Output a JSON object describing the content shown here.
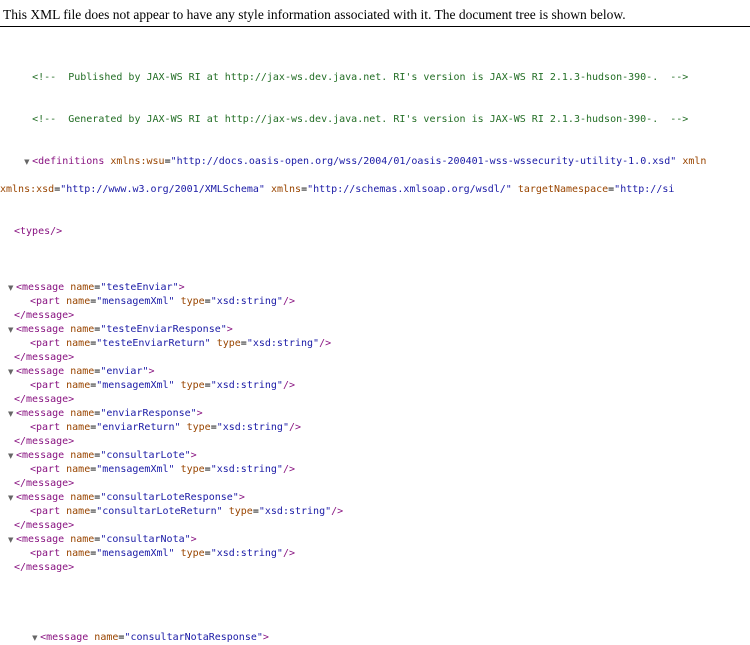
{
  "header": {
    "message": "This XML file does not appear to have any style information associated with it. The document tree is shown below."
  },
  "comments": [
    "<!--  Published by JAX-WS RI at http://jax-ws.dev.java.net. RI's version is JAX-WS RI 2.1.3-hudson-390-.  -->",
    "<!--  Generated by JAX-WS RI at http://jax-ws.dev.java.net. RI's version is JAX-WS RI 2.1.3-hudson-390-.  -->"
  ],
  "definitions": {
    "open_tag": "<definitions",
    "attr1_name": "xmlns:wsu",
    "attr1_value": "\"http://docs.oasis-open.org/wss/2004/01/oasis-200401-wss-wssecurity-utility-1.0.xsd\"",
    "attr2_name": "xmln",
    "line2_attr1_name": "xmlns:xsd",
    "line2_attr1_value": "\"http://www.w3.org/2001/XMLSchema\"",
    "line2_attr2_name": "xmlns",
    "line2_attr2_value": "\"http://schemas.xmlsoap.org/wsdl/\"",
    "line2_attr3_name": "targetNamespace",
    "line2_attr3_value": "\"http://si"
  },
  "types_tag": "<types/>",
  "messages": [
    {
      "name": "testeEnviar",
      "part": "mensagemXml",
      "type": "xsd:string"
    },
    {
      "name": "testeEnviarResponse",
      "part": "testeEnviarReturn",
      "type": "xsd:string"
    },
    {
      "name": "enviar",
      "part": "mensagemXml",
      "type": "xsd:string"
    },
    {
      "name": "enviarResponse",
      "part": "enviarReturn",
      "type": "xsd:string"
    },
    {
      "name": "consultarLote",
      "part": "mensagemXml",
      "type": "xsd:string"
    },
    {
      "name": "consultarLoteResponse",
      "part": "consultarLoteReturn",
      "type": "xsd:string"
    },
    {
      "name": "consultarNota",
      "part": "mensagemXml",
      "type": "xsd:string"
    }
  ],
  "partial_last": {
    "name": "consultarNotaResponse"
  },
  "syntax": {
    "message_open": "<message",
    "name_attr": "name",
    "part_open": "<part",
    "type_attr": "type",
    "self_close": "/>",
    "close_bracket": ">",
    "message_close": "</message>",
    "toggle_glyph": "▼"
  }
}
